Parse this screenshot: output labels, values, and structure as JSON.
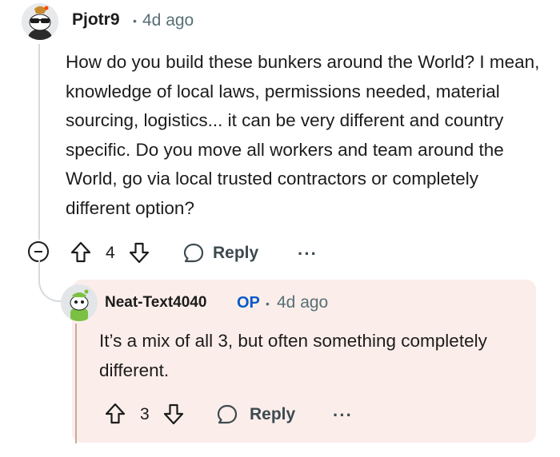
{
  "parent_comment": {
    "username": "Pjotr9",
    "separator": "•",
    "timestamp": "4d ago",
    "body": "How do you build these bunkers around the World? I mean, knowledge of local laws, permissions needed, material sourcing, logistics... it can be very different and country specific. Do you move all workers and team around the World, go via local trusted contractors or completely different option?",
    "vote_count": "4",
    "reply_label": "Reply",
    "more_label": "···",
    "icons": [
      "avatar-sunglasses-icon",
      "collapse-icon",
      "upvote-icon",
      "downvote-icon",
      "reply-bubble-icon",
      "more-icon"
    ]
  },
  "reply_comment": {
    "username": "Neat-Text4040",
    "op_badge": "OP",
    "separator": "•",
    "timestamp": "4d ago",
    "body": "It’s a mix of all 3, but often something completely different.",
    "vote_count": "3",
    "reply_label": "Reply",
    "more_label": "···",
    "icons": [
      "avatar-snoo-icon",
      "upvote-icon",
      "downvote-icon",
      "reply-bubble-icon",
      "more-icon"
    ]
  },
  "colors": {
    "text": "#1c1c1c",
    "meta": "#576f76",
    "op_blue": "#0b59c6",
    "reply_background": "#fbeeea",
    "thread_line": "#d7dadc"
  }
}
